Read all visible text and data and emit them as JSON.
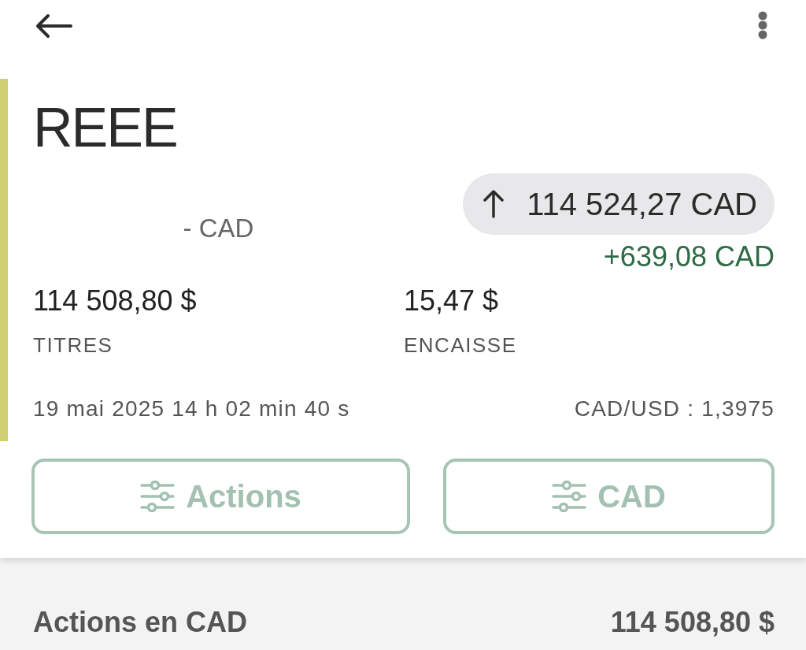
{
  "account": {
    "title": "REEE",
    "change_label": "- CAD",
    "total": {
      "rising": true,
      "value": "114 524,27 CAD"
    },
    "gain": "+639,08 CAD"
  },
  "balances": [
    {
      "value": "114 508,80 $",
      "label": "TITRES"
    },
    {
      "value": "15,47 $",
      "label": "ENCAISSE"
    }
  ],
  "timestamp": "19 mai 2025 14 h 02 min 40 s",
  "exchange_rate": "CAD/USD : 1,3975",
  "filters": [
    {
      "label": "Actions"
    },
    {
      "label": "CAD"
    }
  ],
  "section": {
    "title": "Actions en CAD",
    "total": "114 508,80 $"
  }
}
